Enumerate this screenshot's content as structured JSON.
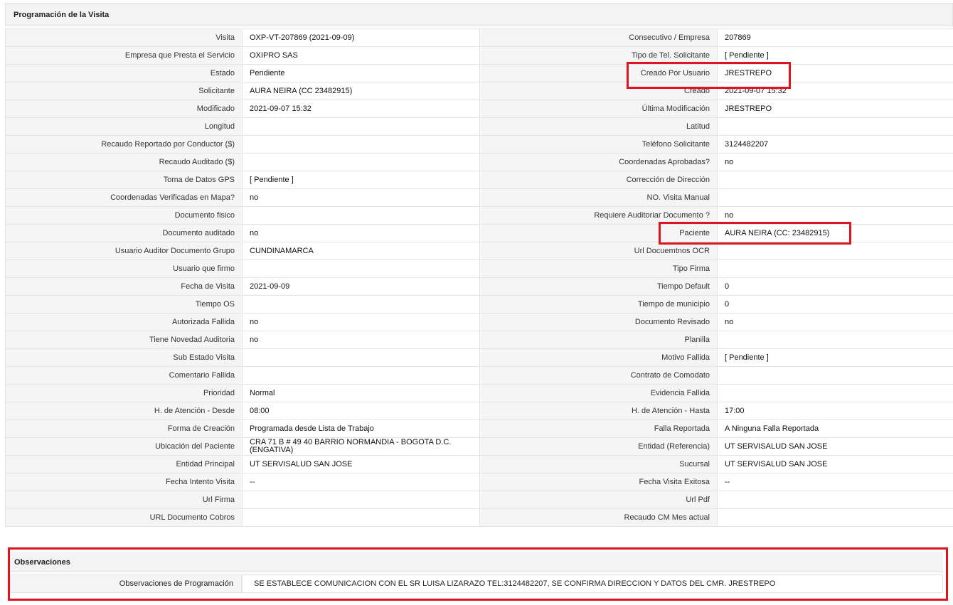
{
  "panel": {
    "title": "Programación de la Visita"
  },
  "rows": [
    {
      "l1": "Visita",
      "v1": "OXP-VT-207869 (2021-09-09)",
      "l2": "Consecutivo / Empresa",
      "v2": "207869"
    },
    {
      "l1": "Empresa que Presta el Servicio",
      "v1": "OXIPRO SAS",
      "l2": "Tipo de Tel. Solicitante",
      "v2": "[ Pendiente ]"
    },
    {
      "l1": "Estado",
      "v1": "Pendiente",
      "l2": "Creado Por Usuario",
      "v2": "JRESTREPO"
    },
    {
      "l1": "Solicitante",
      "v1": "AURA NEIRA (CC 23482915)",
      "l2": "Creado",
      "v2": "2021-09-07 15:32"
    },
    {
      "l1": "Modificado",
      "v1": "2021-09-07 15:32",
      "l2": "Última Modificación",
      "v2": " JRESTREPO"
    },
    {
      "l1": "Longitud",
      "v1": "",
      "l2": "Latitud",
      "v2": ""
    },
    {
      "l1": "Recaudo Reportado por Conductor ($)",
      "v1": "",
      "l2": "Teléfono Solicitante",
      "v2": "3124482207"
    },
    {
      "l1": "Recaudo Auditado ($)",
      "v1": "",
      "l2": "Coordenadas Aprobadas?",
      "v2": " no"
    },
    {
      "l1": "Toma de Datos GPS",
      "v1": "[ Pendiente ]",
      "l2": "Corrección de Dirección",
      "v2": ""
    },
    {
      "l1": "Coordenadas Verificadas en Mapa?",
      "v1": " no",
      "l2": "NO. Visita Manual",
      "v2": ""
    },
    {
      "l1": "Documento fisico",
      "v1": "",
      "l2": "Requiere Auditoriar Documento ?",
      "v2": " no"
    },
    {
      "l1": "Documento auditado",
      "v1": " no",
      "l2": "Paciente",
      "v2": "AURA NEIRA (CC: 23482915)"
    },
    {
      "l1": "Usuario Auditor Documento Grupo",
      "v1": "CUNDINAMARCA",
      "l2": "Url Docuemtnos OCR",
      "v2": ""
    },
    {
      "l1": "Usuario que firmo",
      "v1": "",
      "l2": "Tipo Firma",
      "v2": ""
    },
    {
      "l1": "Fecha de Visita",
      "v1": " 2021-09-09",
      "l2": "Tiempo Default",
      "v2": "0"
    },
    {
      "l1": "Tiempo OS",
      "v1": "",
      "l2": "Tiempo de municipio",
      "v2": "0"
    },
    {
      "l1": "Autorizada Fallida",
      "v1": " no",
      "l2": "Documento Revisado",
      "v2": " no"
    },
    {
      "l1": "Tiene Novedad Auditoria",
      "v1": " no",
      "l2": "Planilla",
      "v2": ""
    },
    {
      "l1": "Sub Estado Visita",
      "v1": "",
      "l2": "Motivo Fallida",
      "v2": "[ Pendiente ]"
    },
    {
      "l1": "Comentario Fallida",
      "v1": "",
      "l2": "Contrato de Comodato",
      "v2": ""
    },
    {
      "l1": "Prioridad",
      "v1": "Normal",
      "l2": "Evidencia Fallida",
      "v2": ""
    },
    {
      "l1": "H. de Atención - Desde",
      "v1": "08:00",
      "l2": "H. de Atención - Hasta",
      "v2": "17:00"
    },
    {
      "l1": "Forma de Creación",
      "v1": "Programada desde Lista de Trabajo",
      "l2": "Falla Reportada",
      "v2": "A Ninguna Falla Reportada"
    },
    {
      "l1": "Ubicación del Paciente",
      "v1": "CRA 71 B # 49 40 BARRIO NORMANDIA - BOGOTA D.C. (ENGATIVA)",
      "l2": "Entidad (Referencia)",
      "v2": "UT SERVISALUD SAN JOSE"
    },
    {
      "l1": "Entidad Principal",
      "v1": "UT SERVISALUD SAN JOSE",
      "l2": "Sucursal",
      "v2": "UT SERVISALUD SAN JOSE"
    },
    {
      "l1": "Fecha Intento Visita",
      "v1": " --",
      "l2": "Fecha Visita Exitosa",
      "v2": " --"
    },
    {
      "l1": "Url Firma",
      "v1": "",
      "l2": "Url Pdf",
      "v2": ""
    },
    {
      "l1": "URL Documento Cobros",
      "v1": "",
      "l2": "Recaudo CM Mes actual",
      "v2": ""
    }
  ],
  "observaciones": {
    "title": "Observaciones",
    "label": "Observaciones de Programación",
    "value": "SE ESTABLECE COMUNICACION CON EL SR LUISA LIZARAZO TEL:3124482207, SE CONFIRMA DIRECCION Y DATOS DEL CMR. JRESTREPO"
  },
  "colors": {
    "highlight": "#e0141e",
    "label_bg": "#f5f5f5",
    "header_bg": "#f3f3f3"
  }
}
